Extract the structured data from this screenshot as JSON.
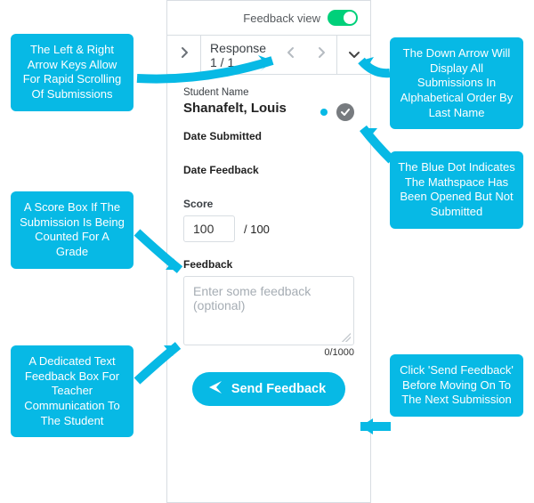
{
  "header": {
    "feedback_view_label": "Feedback view"
  },
  "nav": {
    "response_label": "Response 1 / 1"
  },
  "student": {
    "label": "Student Name",
    "name": "Shanafelt, Louis",
    "date_submitted_label": "Date Submitted",
    "date_feedback_label": "Date Feedback"
  },
  "score": {
    "label": "Score",
    "value": "100",
    "max": "/ 100"
  },
  "feedback": {
    "label": "Feedback",
    "placeholder": "Enter some feedback (optional)",
    "counter": "0/1000"
  },
  "send": {
    "label": "Send Feedback"
  },
  "callouts": {
    "c1": "The Left & Right Arrow Keys Allow For Rapid Scrolling Of Submissions",
    "c2": "The Down Arrow Will Display All Submissions In Alphabetical Order By Last Name",
    "c3": "A Score Box If The Submission Is Being Counted For A Grade",
    "c4": "The Blue Dot Indicates The Mathspace Has Been Opened But Not Submitted",
    "c5": "A Dedicated Text Feedback Box For Teacher Communication To The Student",
    "c6": "Click 'Send Feedback' Before Moving On To The Next Submission"
  }
}
